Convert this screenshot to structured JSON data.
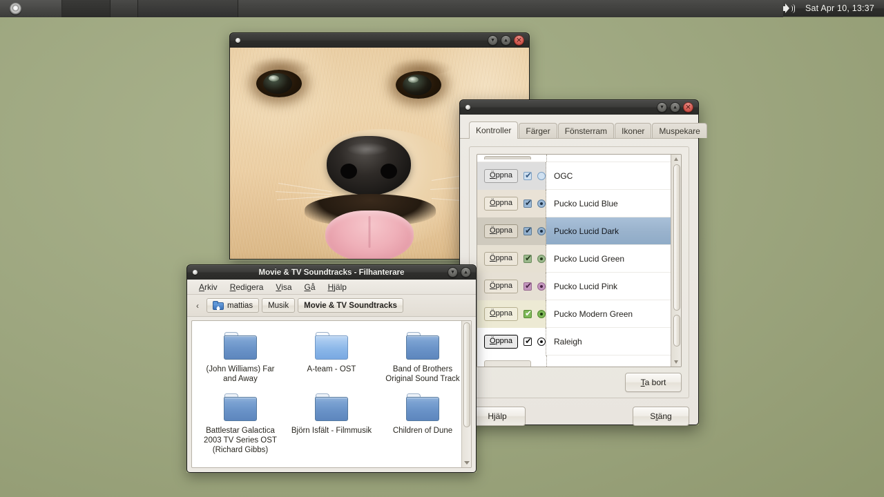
{
  "panel": {
    "start_icon": "start-orb-icon",
    "volume_icon": "volume-speaker-icon",
    "clock": "Sat Apr  10, 13:37"
  },
  "viewer": {
    "title": "",
    "photo_alt": "golden-retriever-puppy-closeup",
    "buttons": {
      "minimize": "▾",
      "maximize": "▴",
      "close": "✕"
    }
  },
  "filemanager": {
    "title": "Movie & TV Soundtracks - Filhanterare",
    "menu": [
      "Arkiv",
      "Redigera",
      "Visa",
      "Gå",
      "Hjälp"
    ],
    "menu_accel": [
      "A",
      "R",
      "V",
      "G",
      "H"
    ],
    "nav_back": "‹",
    "breadcrumb": [
      {
        "label": "mattias",
        "icon": "home-folder-icon",
        "current": false
      },
      {
        "label": "Musik",
        "icon": "",
        "current": false
      },
      {
        "label": "Movie & TV Soundtracks",
        "icon": "",
        "current": true
      }
    ],
    "items": [
      {
        "name": "(John Williams) Far and Away",
        "selected": false
      },
      {
        "name": "A-team - OST",
        "selected": true
      },
      {
        "name": "Band of Brothers Original Sound Track",
        "selected": false
      },
      {
        "name": "Battlestar Galactica 2003 TV Series OST (Richard Gibbs)",
        "selected": false
      },
      {
        "name": "Björn Isfält - Filmmusik",
        "selected": false
      },
      {
        "name": "Children of Dune",
        "selected": false
      }
    ]
  },
  "theme": {
    "title": "",
    "tabs": [
      {
        "label": "Kontroller",
        "active": true
      },
      {
        "label": "Färger",
        "active": false
      },
      {
        "label": "Fönsterram",
        "active": false
      },
      {
        "label": "Ikoner",
        "active": false
      },
      {
        "label": "Muspekare",
        "active": false
      }
    ],
    "preview_button_label": "Öppna",
    "preview_button_accel": "Ö",
    "check_glyph": "✔",
    "rows": [
      {
        "label": "OGC",
        "selected": false,
        "swatch_bg": "#dedede",
        "btn_bg": "#e6e6e6",
        "btn_border": "#9e9e9e",
        "btn_text": "#1d1d1d",
        "cb_bg": "#cfe0f0",
        "cb_border": "#7b9fc2",
        "cb_check": "#355b85",
        "rd_bg": "#cfe0f0",
        "rd_border": "#7b9fc2",
        "rd_dot": "#cfe0f0"
      },
      {
        "label": "Pucko Lucid Blue",
        "selected": false,
        "swatch_bg": "#e9e2d6",
        "btn_bg": "#efe9dd",
        "btn_border": "#b0a893",
        "btn_text": "#1d1d1d",
        "cb_bg": "#9cb9d6",
        "cb_border": "#5f7e9c",
        "cb_check": "#22354a",
        "rd_bg": "#9cb9d6",
        "rd_border": "#5f7e9c",
        "rd_dot": "#22354a"
      },
      {
        "label": "Pucko Lucid Dark",
        "selected": true,
        "swatch_bg": "#cfcabe",
        "btn_bg": "#ded8cb",
        "btn_border": "#9d9684",
        "btn_text": "#1d1d1d",
        "cb_bg": "#93b0cd",
        "cb_border": "#5a7993",
        "cb_check": "#1d2f42",
        "rd_bg": "#93b0cd",
        "rd_border": "#5a7993",
        "rd_dot": "#1d2f42"
      },
      {
        "label": "Pucko Lucid Green",
        "selected": false,
        "swatch_bg": "#e6e0d2",
        "btn_bg": "#ece6d9",
        "btn_border": "#aea792",
        "btn_text": "#1d1d1d",
        "cb_bg": "#9bb98c",
        "cb_border": "#6b8a5d",
        "cb_check": "#24391a",
        "rd_bg": "#9bb98c",
        "rd_border": "#6b8a5d",
        "rd_dot": "#24391a"
      },
      {
        "label": "Pucko Lucid Pink",
        "selected": false,
        "swatch_bg": "#e6e0d4",
        "btn_bg": "#ece6da",
        "btn_border": "#aea792",
        "btn_text": "#1d1d1d",
        "cb_bg": "#c396be",
        "cb_border": "#97688f",
        "cb_check": "#4a2344",
        "rd_bg": "#c396be",
        "rd_border": "#97688f",
        "rd_dot": "#4a2344"
      },
      {
        "label": "Pucko Modern Green",
        "selected": false,
        "swatch_bg": "#edead4",
        "btn_bg": "#f1eedc",
        "btn_border": "#b6b08f",
        "btn_text": "#1d1d1d",
        "cb_bg": "#7fb959",
        "cb_border": "#558a33",
        "cb_check": "#ffffff",
        "rd_bg": "#7fb959",
        "rd_border": "#558a33",
        "rd_dot": "#1d3b10"
      },
      {
        "label": "Raleigh",
        "selected": false,
        "swatch_bg": "#ffffff",
        "btn_bg": "#e9e9e9",
        "btn_border": "#000000",
        "btn_text": "#000000",
        "cb_bg": "#ffffff",
        "cb_border": "#111111",
        "cb_check": "#111111",
        "rd_bg": "#ffffff",
        "rd_border": "#111111",
        "rd_dot": "#111111"
      }
    ],
    "remove_button": "Ta bort",
    "remove_button_accel": "T",
    "help_button": "Hjälp",
    "help_button_accel": "j",
    "close_button": "Stäng",
    "close_button_accel": "t",
    "buttons": {
      "minimize": "▾",
      "maximize": "▴",
      "close": "✕"
    }
  }
}
